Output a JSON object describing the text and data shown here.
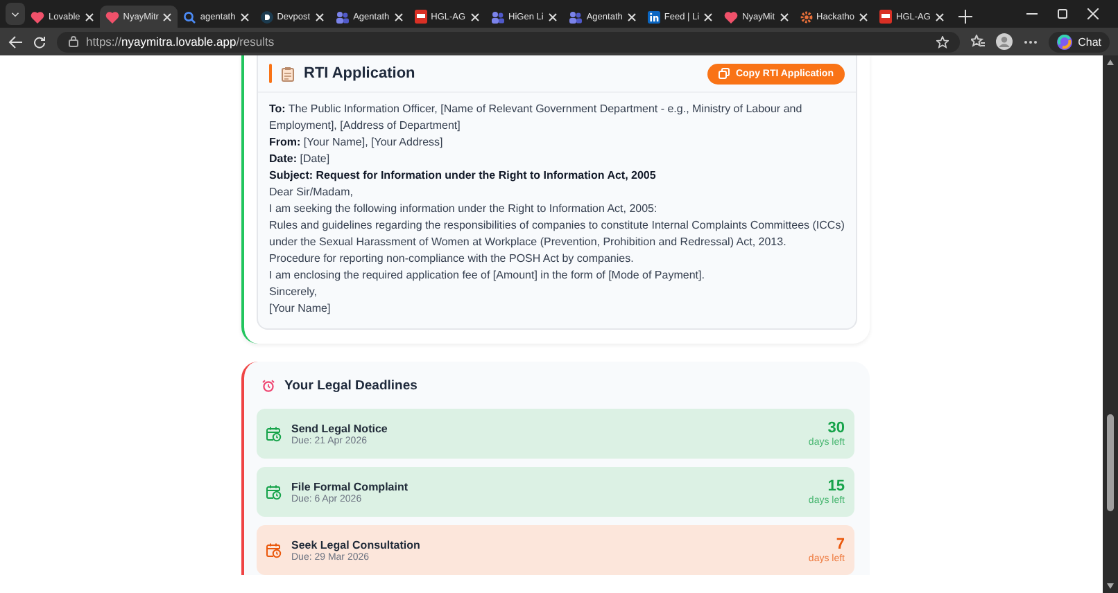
{
  "browser": {
    "tabs": [
      {
        "label": "Lovable",
        "selected": false,
        "kind": "heart"
      },
      {
        "label": "NyayMitr",
        "selected": true,
        "kind": "heart"
      },
      {
        "label": "agentath",
        "selected": false,
        "kind": "search"
      },
      {
        "label": "Devpost",
        "selected": false,
        "kind": "d"
      },
      {
        "label": "Agentath",
        "selected": false,
        "kind": "team"
      },
      {
        "label": "HGL-AG",
        "selected": false,
        "kind": "pdf"
      },
      {
        "label": "HiGen Li",
        "selected": false,
        "kind": "team"
      },
      {
        "label": "Agentath",
        "selected": false,
        "kind": "team"
      },
      {
        "label": "Feed | Li",
        "selected": false,
        "kind": "in"
      },
      {
        "label": "NyayMit",
        "selected": false,
        "kind": "heart"
      },
      {
        "label": "Hackatho",
        "selected": false,
        "kind": "gear"
      },
      {
        "label": "HGL-AG",
        "selected": false,
        "kind": "pdf"
      }
    ],
    "address": {
      "scheme": "https://",
      "host": "nyaymitra.lovable.app",
      "path": "/results"
    },
    "chat_label": "Chat"
  },
  "rti": {
    "title": "RTI Application",
    "copy_button": "Copy RTI Application",
    "lines": [
      {
        "kind": "plain",
        "text": "**To:** The Public Information Officer, [Name of Relevant Government Department - e.g., Ministry of Labour and Employment], [Address of Department]"
      },
      {
        "kind": "plain",
        "text": "**From:** [Your Name], [Your Address]"
      },
      {
        "kind": "plain",
        "text": "**Date:** [Date]"
      },
      {
        "kind": "subject",
        "text": "Subject: Request for Information under the Right to Information Act, 2005"
      },
      {
        "kind": "plain",
        "text": "Dear Sir/Madam,"
      },
      {
        "kind": "plain",
        "text": "I am seeking the following information under the Right to Information Act, 2005:"
      },
      {
        "kind": "plain",
        "text": "Rules and guidelines regarding the responsibilities of companies to constitute Internal Complaints Committees (ICCs) under the Sexual Harassment of Women at Workplace (Prevention, Prohibition and Redressal) Act, 2013."
      },
      {
        "kind": "plain",
        "text": "Procedure for reporting non-compliance with the POSH Act by companies."
      },
      {
        "kind": "plain",
        "text": "I am enclosing the required application fee of [Amount] in the form of [Mode of Payment]."
      },
      {
        "kind": "plain",
        "text": "Sincerely,"
      },
      {
        "kind": "plain",
        "text": "[Your Name]"
      }
    ]
  },
  "deadlines": {
    "title": "Your Legal Deadlines",
    "items": [
      {
        "title": "Send Legal Notice",
        "due": "Due: 21 Apr 2026",
        "days": "30",
        "days_label": "days left",
        "color": "#16a34a"
      },
      {
        "title": "File Formal Complaint",
        "due": "Due: 6 Apr 2026",
        "days": "15",
        "days_label": "days left",
        "color": "#16a34a"
      },
      {
        "title": "Seek Legal Consultation",
        "due": "Due: 29 Mar 2026",
        "days": "7",
        "days_label": "days left",
        "color": "#ea580c"
      }
    ]
  }
}
